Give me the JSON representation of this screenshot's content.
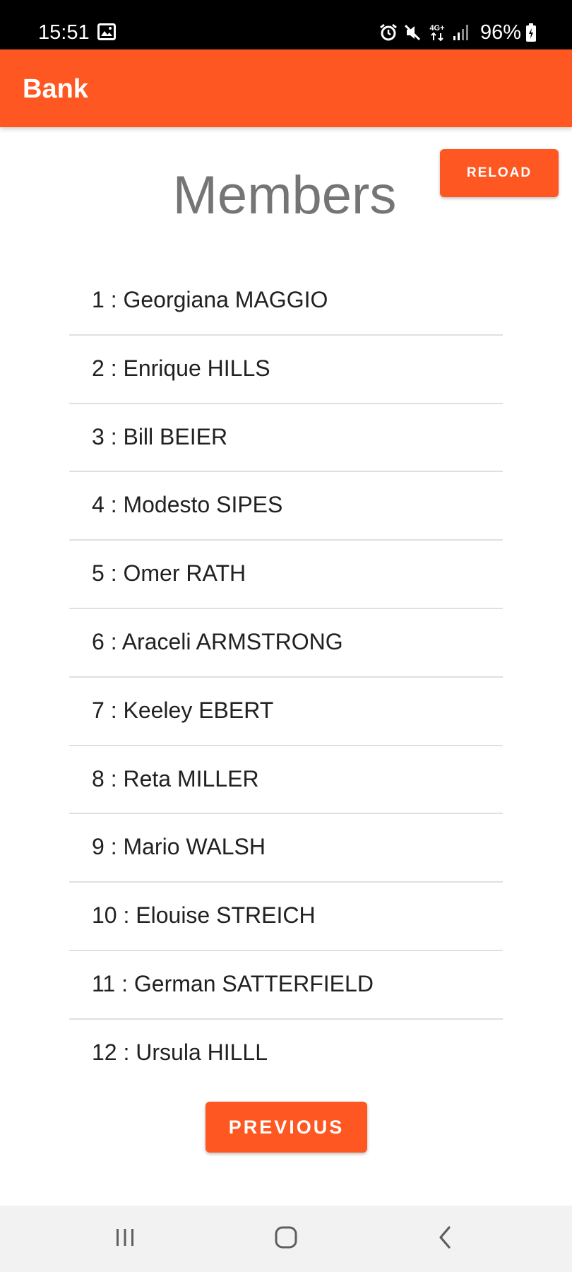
{
  "status_bar": {
    "time": "15:51",
    "network": "4G+",
    "battery": "96%",
    "icons": [
      "gallery-icon",
      "alarm-icon",
      "mute-icon",
      "data-4g-icon",
      "signal-icon",
      "battery-charging-icon"
    ]
  },
  "app_bar": {
    "title": "Bank",
    "color": "#FF5722"
  },
  "toolbar": {
    "reload_label": "RELOAD"
  },
  "page": {
    "title": "Members"
  },
  "members": [
    {
      "text": "1 : Georgiana MAGGIO"
    },
    {
      "text": "2 : Enrique HILLS"
    },
    {
      "text": "3 : Bill BEIER"
    },
    {
      "text": "4 : Modesto SIPES"
    },
    {
      "text": "5 : Omer RATH"
    },
    {
      "text": "6 : Araceli ARMSTRONG"
    },
    {
      "text": "7 : Keeley EBERT"
    },
    {
      "text": "8 : Reta MILLER"
    },
    {
      "text": "9 : Mario WALSH"
    },
    {
      "text": "10 : Elouise STREICH"
    },
    {
      "text": "11 : German SATTERFIELD"
    },
    {
      "text": "12 : Ursula HILLL"
    }
  ],
  "pagination": {
    "previous_label": "PREVIOUS"
  },
  "nav_bar": {
    "icons": [
      "recents-icon",
      "home-icon",
      "back-icon"
    ]
  }
}
